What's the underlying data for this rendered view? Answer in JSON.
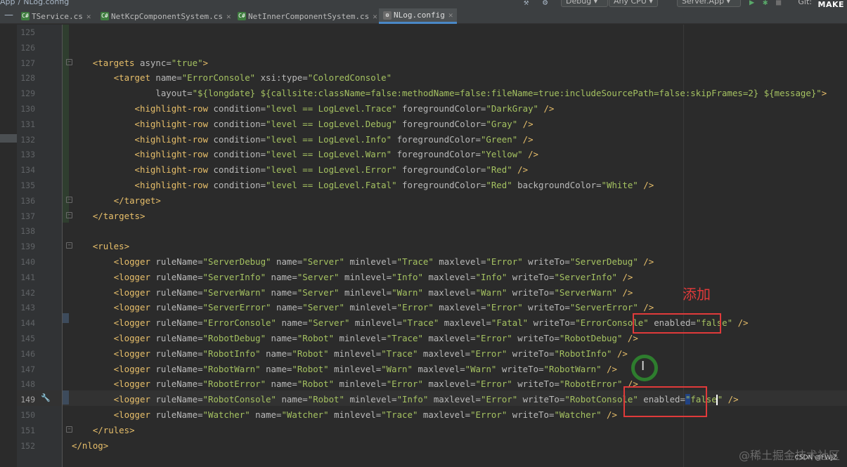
{
  "toolbar": {
    "breadcrumb": [
      "App",
      "/",
      "NLog.config"
    ],
    "config_combo": "Debug",
    "platform_combo": "Any CPU",
    "run_combo": "Server.App",
    "git_label": "Git:",
    "make_label": "MAKE"
  },
  "tabs": [
    {
      "label": "TService.cs",
      "icon": "csharp-file-icon",
      "active": false
    },
    {
      "label": "NetKcpComponentSystem.cs",
      "icon": "csharp-file-icon",
      "active": false
    },
    {
      "label": "NetInnerComponentSystem.cs",
      "icon": "csharp-file-icon",
      "active": false
    },
    {
      "label": "NLog.config",
      "icon": "config-file-icon",
      "active": true
    }
  ],
  "editor": {
    "current_line": 149,
    "lines": [
      {
        "num": "125",
        "text": ""
      },
      {
        "num": "126",
        "text": ""
      },
      {
        "num": "127",
        "text": "    <targets async=\"true\">"
      },
      {
        "num": "128",
        "text": "        <target name=\"ErrorConsole\" xsi:type=\"ColoredConsole\""
      },
      {
        "num": "129",
        "text": "                layout=\"${longdate} ${callsite:className=false:methodName=false:fileName=true:includeSourcePath=false:skipFrames=2} ${message}\">"
      },
      {
        "num": "130",
        "text": "            <highlight-row condition=\"level == LogLevel.Trace\" foregroundColor=\"DarkGray\" />"
      },
      {
        "num": "131",
        "text": "            <highlight-row condition=\"level == LogLevel.Debug\" foregroundColor=\"Gray\" />"
      },
      {
        "num": "132",
        "text": "            <highlight-row condition=\"level == LogLevel.Info\" foregroundColor=\"Green\" />"
      },
      {
        "num": "133",
        "text": "            <highlight-row condition=\"level == LogLevel.Warn\" foregroundColor=\"Yellow\" />"
      },
      {
        "num": "134",
        "text": "            <highlight-row condition=\"level == LogLevel.Error\" foregroundColor=\"Red\" />"
      },
      {
        "num": "135",
        "text": "            <highlight-row condition=\"level == LogLevel.Fatal\" foregroundColor=\"Red\" backgroundColor=\"White\" />"
      },
      {
        "num": "136",
        "text": "        </target>"
      },
      {
        "num": "137",
        "text": "    </targets>"
      },
      {
        "num": "138",
        "text": ""
      },
      {
        "num": "139",
        "text": "    <rules>"
      },
      {
        "num": "140",
        "text": "        <logger ruleName=\"ServerDebug\" name=\"Server\" minlevel=\"Trace\" maxlevel=\"Error\" writeTo=\"ServerDebug\" />"
      },
      {
        "num": "141",
        "text": "        <logger ruleName=\"ServerInfo\" name=\"Server\" minlevel=\"Info\" maxlevel=\"Info\" writeTo=\"ServerInfo\" />"
      },
      {
        "num": "142",
        "text": "        <logger ruleName=\"ServerWarn\" name=\"Server\" minlevel=\"Warn\" maxlevel=\"Warn\" writeTo=\"ServerWarn\" />"
      },
      {
        "num": "143",
        "text": "        <logger ruleName=\"ServerError\" name=\"Server\" minlevel=\"Error\" maxlevel=\"Error\" writeTo=\"ServerError\" />"
      },
      {
        "num": "144",
        "text": "        <logger ruleName=\"ErrorConsole\" name=\"Server\" minlevel=\"Trace\" maxlevel=\"Fatal\" writeTo=\"ErrorConsole\" enabled=\"false\" />"
      },
      {
        "num": "145",
        "text": "        <logger ruleName=\"RobotDebug\" name=\"Robot\" minlevel=\"Trace\" maxlevel=\"Error\" writeTo=\"RobotDebug\" />"
      },
      {
        "num": "146",
        "text": "        <logger ruleName=\"RobotInfo\" name=\"Robot\" minlevel=\"Trace\" maxlevel=\"Error\" writeTo=\"RobotInfo\" />"
      },
      {
        "num": "147",
        "text": "        <logger ruleName=\"RobotWarn\" name=\"Robot\" minlevel=\"Warn\" maxlevel=\"Warn\" writeTo=\"RobotWarn\" />"
      },
      {
        "num": "148",
        "text": "        <logger ruleName=\"RobotError\" name=\"Robot\" minlevel=\"Error\" maxlevel=\"Error\" writeTo=\"RobotError\" />"
      },
      {
        "num": "149",
        "text": "        <logger ruleName=\"RobotConsole\" name=\"Robot\" minlevel=\"Info\" maxlevel=\"Error\" writeTo=\"RobotConsole\" enabled=\"false\" />"
      },
      {
        "num": "150",
        "text": "        <logger ruleName=\"Watcher\" name=\"Watcher\" minlevel=\"Trace\" maxlevel=\"Error\" writeTo=\"Watcher\" />"
      },
      {
        "num": "151",
        "text": "    </rules>"
      },
      {
        "num": "152",
        "text": "</nlog>"
      }
    ]
  },
  "annotation": {
    "label": "添加",
    "color": "#e03a3a"
  },
  "watermark": {
    "text": "@稀土掘金技术社区",
    "sub": "CSDN @FWJZ"
  },
  "colors": {
    "tag": "#e8bf6a",
    "attribute": "#bababa",
    "value": "#a5c261",
    "background": "#2b2b2b",
    "gutter": "#313335",
    "selection": "#214283"
  }
}
